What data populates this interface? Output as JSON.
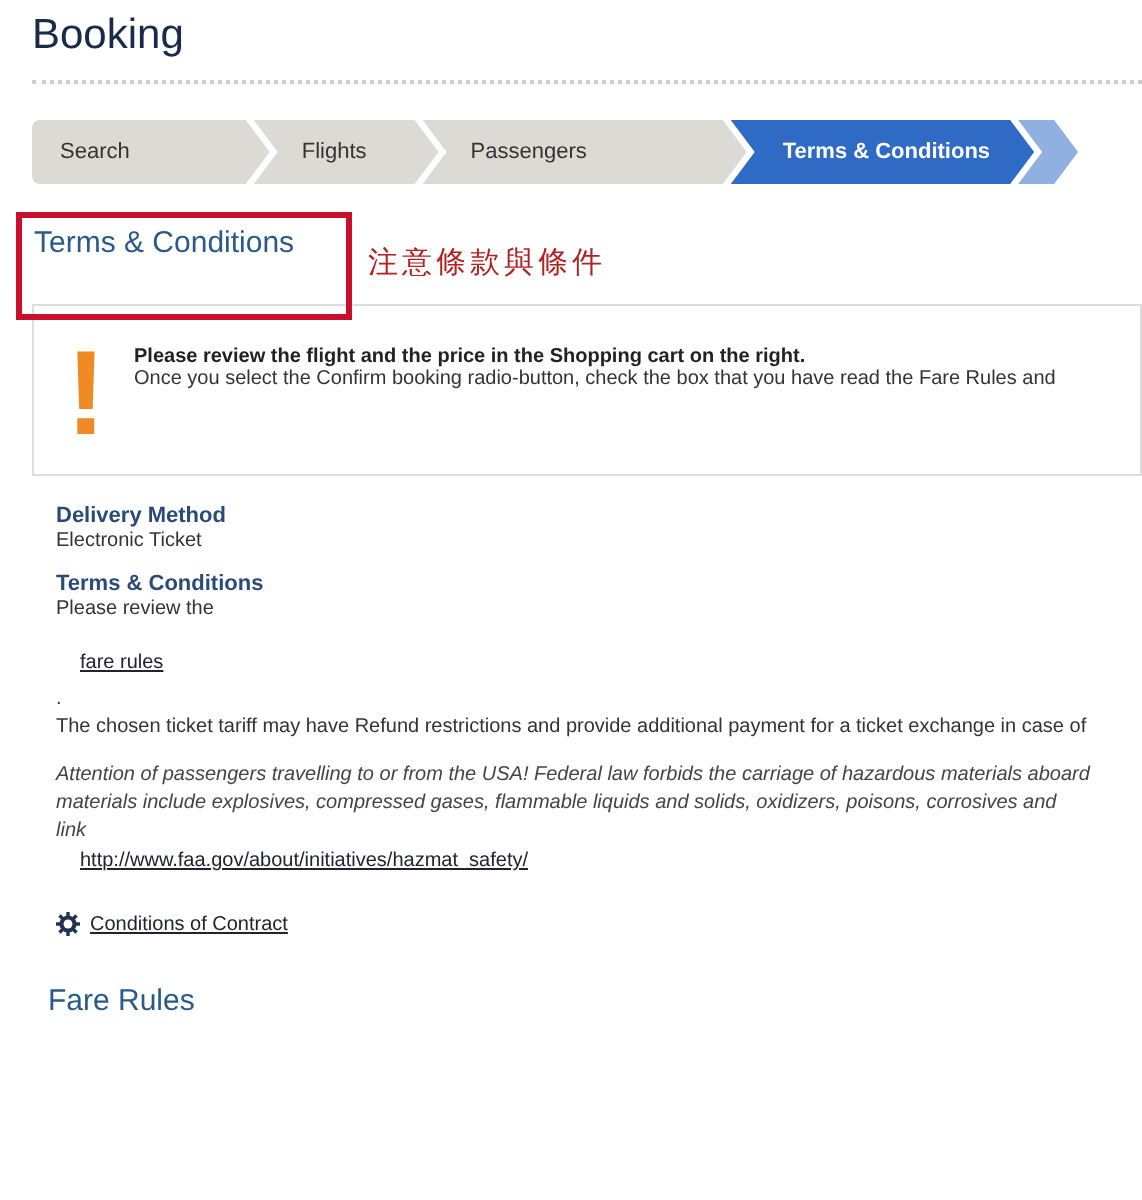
{
  "page": {
    "title": "Booking"
  },
  "steps": [
    {
      "label": "Search",
      "selected": false
    },
    {
      "label": "Flights",
      "selected": false
    },
    {
      "label": "Passengers",
      "selected": false
    },
    {
      "label": "Terms & Conditions",
      "selected": true
    }
  ],
  "section": {
    "title": "Terms & Conditions",
    "annotation": "注意條款與條件"
  },
  "notice": {
    "icon": "!",
    "headline": "Please review the flight and the price in the Shopping cart on the right.",
    "text": "Once you select the Confirm booking radio-button, check the box that you have read the Fare Rules and"
  },
  "details": [
    {
      "heading": "Delivery Method",
      "text": "Electronic Ticket"
    },
    {
      "heading": "Terms & Conditions",
      "text": "Please review the"
    }
  ],
  "fare_rules_link": "fare rules",
  "period": ".",
  "tariff_note": "The chosen ticket tariff may have Refund restrictions and provide additional payment for a ticket exchange in case of",
  "hazmat_note": "Attention of passengers travelling to or from the USA! Federal law forbids the carriage of hazardous materials aboard materials include explosives, compressed gases, flammable liquids and solids, oxidizers, poisons, corrosives and",
  "hazmat_link_label": "link",
  "hazmat_url": "http://www.faa.gov/about/initiatives/hazmat_safety/",
  "contract_link": "Conditions of Contract",
  "fare_rules_title": "Fare Rules"
}
